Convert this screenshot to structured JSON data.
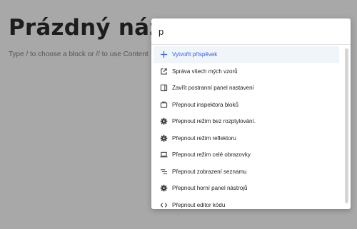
{
  "editor": {
    "title": "Prázdný název",
    "hint": "Type / to choose a block or // to use Content"
  },
  "palette": {
    "search_value": "p",
    "items": [
      {
        "label": "Vytvořit příspěvek",
        "icon": "plus-icon",
        "active": true
      },
      {
        "label": "Správa všech mých vzorů",
        "icon": "external-link-icon",
        "active": false
      },
      {
        "label": "Zavřít postranní panel nastavení",
        "icon": "sidebar-icon",
        "active": false
      },
      {
        "label": "Přepnout inspektora bloků",
        "icon": "block-inspector-icon",
        "active": false
      },
      {
        "label": "Přepnout režim bez rozptylování.",
        "icon": "gear-icon",
        "active": false
      },
      {
        "label": "Přepnout režim reflektoru",
        "icon": "gear-icon",
        "active": false
      },
      {
        "label": "Přepnout režim celé obrazovky",
        "icon": "laptop-icon",
        "active": false
      },
      {
        "label": "Přepnout zobrazení seznamu",
        "icon": "list-view-icon",
        "active": false
      },
      {
        "label": "Přepnout horní panel nástrojů",
        "icon": "gear-icon",
        "active": false
      },
      {
        "label": "Přepnout editor kódu",
        "icon": "code-icon",
        "active": false
      }
    ]
  },
  "colors": {
    "accent": "#3858e9",
    "overlay": "#a8a8a8"
  }
}
